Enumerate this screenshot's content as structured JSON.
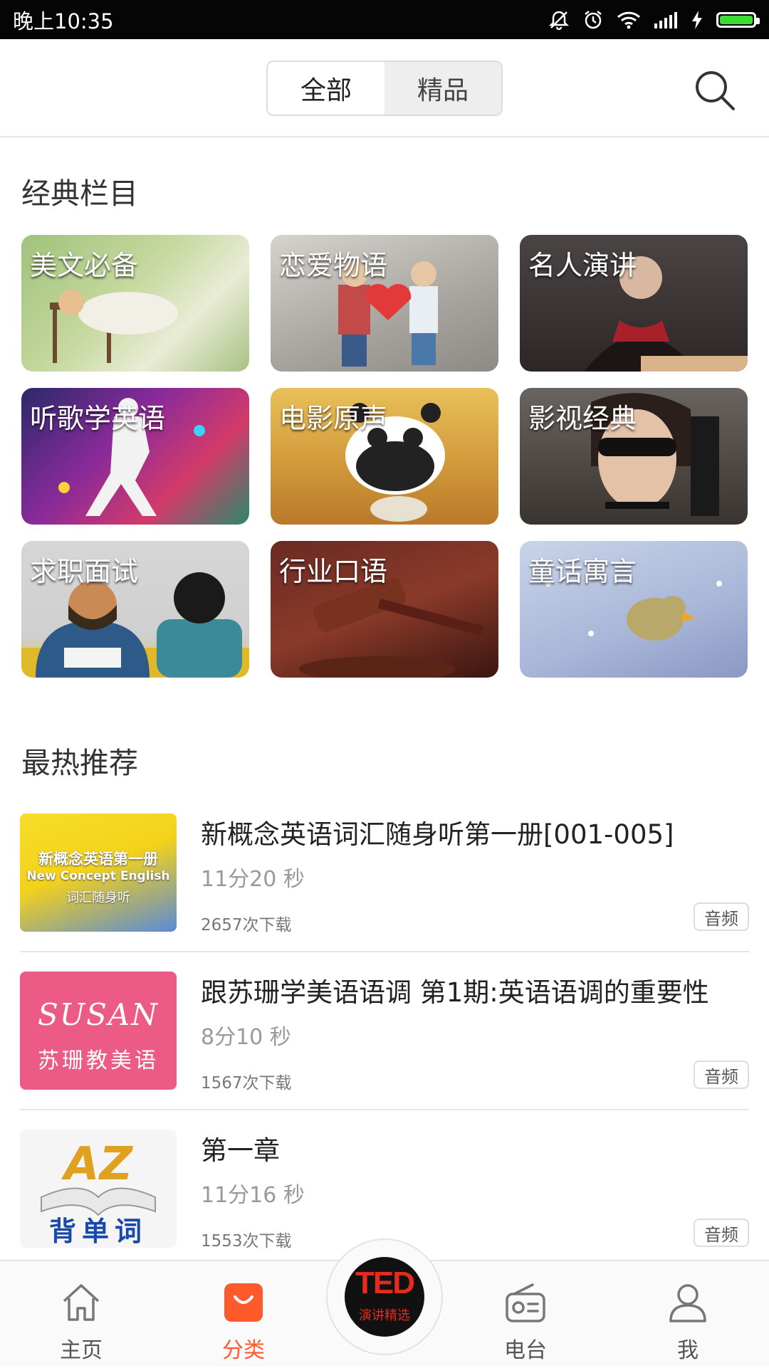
{
  "status_bar": {
    "time": "晚上10:35"
  },
  "header": {
    "tabs": [
      {
        "label": "全部",
        "active": true
      },
      {
        "label": "精品",
        "active": false
      }
    ]
  },
  "classic_section": {
    "title": "经典栏目",
    "categories": [
      {
        "label": "美文必备"
      },
      {
        "label": "恋爱物语"
      },
      {
        "label": "名人演讲"
      },
      {
        "label": "听歌学英语"
      },
      {
        "label": "电影原声"
      },
      {
        "label": "影视经典"
      },
      {
        "label": "求职面试"
      },
      {
        "label": "行业口语"
      },
      {
        "label": "童话寓言"
      }
    ]
  },
  "hot_section": {
    "title": "最热推荐",
    "items": [
      {
        "title": "新概念英语词汇随身听第一册[001-005]",
        "duration": "11分20 秒",
        "downloads": "2657次下载",
        "type": "音频",
        "thumb_lines": [
          "新概念英语第一册",
          "New Concept English",
          "词汇随身听"
        ]
      },
      {
        "title": "跟苏珊学美语语调 第1期:英语语调的重要性",
        "duration": "8分10 秒",
        "downloads": "1567次下载",
        "type": "音频",
        "thumb_lines": [
          "SUSAN",
          "苏珊教美语"
        ]
      },
      {
        "title": "第一章",
        "duration": "11分16 秒",
        "downloads": "1553次下载",
        "type": "音频",
        "thumb_lines": [
          "AZ",
          "背单词"
        ]
      }
    ]
  },
  "bottom_nav": {
    "items": [
      {
        "label": "主页",
        "icon": "home-icon"
      },
      {
        "label": "分类",
        "icon": "bag-icon",
        "active": true
      },
      {
        "label": "电台",
        "icon": "radio-icon"
      },
      {
        "label": "我",
        "icon": "user-icon"
      }
    ],
    "center": {
      "logo": "TED",
      "caption": "演讲精选"
    }
  },
  "colors": {
    "accent": "#ff5a2c",
    "status_bar": "#050505",
    "battery": "#3ddc35"
  }
}
